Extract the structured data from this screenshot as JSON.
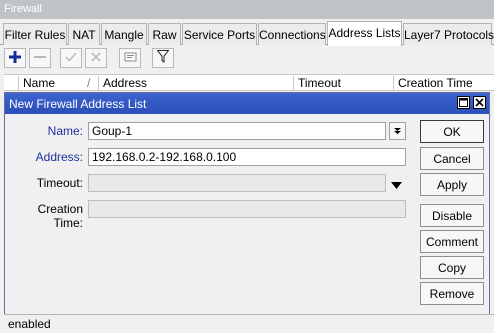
{
  "window": {
    "title": "Firewall"
  },
  "tabs": [
    {
      "label": "Filter Rules"
    },
    {
      "label": "NAT"
    },
    {
      "label": "Mangle"
    },
    {
      "label": "Raw"
    },
    {
      "label": "Service Ports"
    },
    {
      "label": "Connections"
    },
    {
      "label": "Address Lists",
      "active": true
    },
    {
      "label": "Layer7 Protocols"
    }
  ],
  "toolbar": {
    "icons": [
      "plus-icon",
      "minus-icon",
      "check-icon",
      "cross-icon",
      "comment-icon",
      "filter-icon"
    ]
  },
  "list": {
    "columns": [
      "Name",
      "Address",
      "Timeout",
      "Creation Time"
    ]
  },
  "dialog": {
    "title": "New Firewall Address List",
    "fields": {
      "name_label": "Name:",
      "name_value": "Goup-1",
      "address_label": "Address:",
      "address_value": "192.168.0.2-192.168.0.100",
      "timeout_label": "Timeout:",
      "timeout_value": "",
      "creation_label": "Creation Time:",
      "creation_value": ""
    },
    "buttons": {
      "ok": "OK",
      "cancel": "Cancel",
      "apply": "Apply",
      "disable": "Disable",
      "comment": "Comment",
      "copy": "Copy",
      "remove": "Remove"
    }
  },
  "status": {
    "text": "enabled"
  },
  "colors": {
    "title_bar": "#2c4fb8",
    "label_blue": "#1c2fa0",
    "add_icon": "#1a2a9c"
  }
}
